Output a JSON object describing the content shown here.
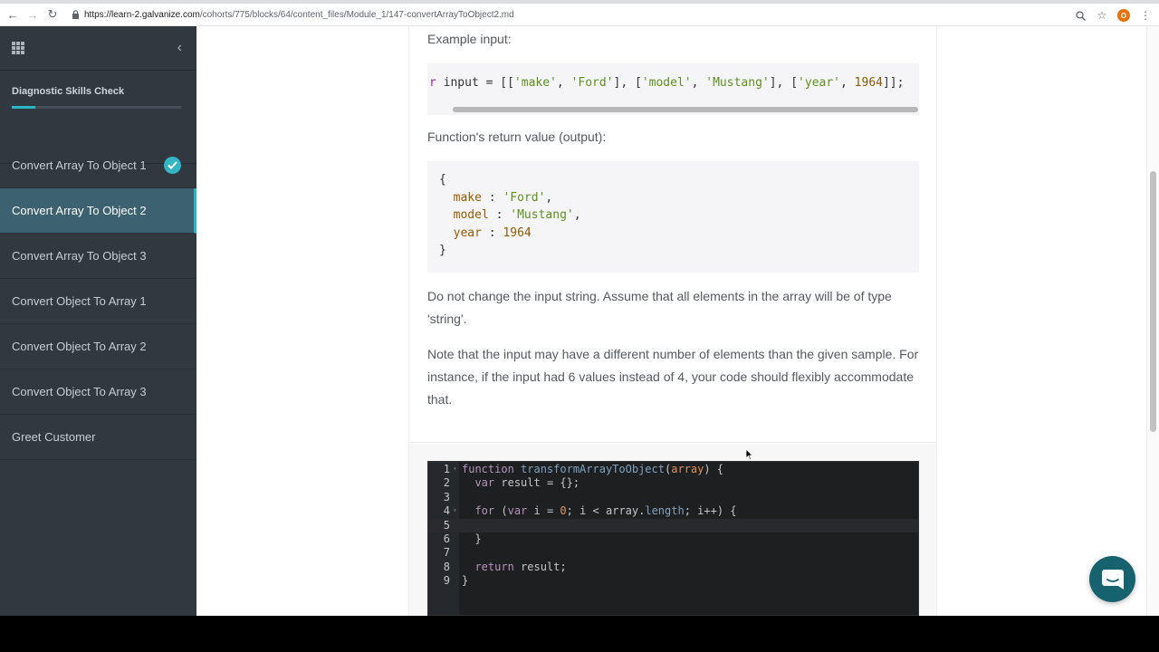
{
  "browser": {
    "url_host": "https://learn-2.galvanize.com",
    "url_path": "/cohorts/775/blocks/64/content_files/Module_1/147-convertArrayToObject2.md",
    "profile_initial": "O"
  },
  "sidebar": {
    "title": "Diagnostic Skills Check",
    "progress": 0.14,
    "items": [
      {
        "label": "Convert Array To Object 1",
        "completed": true
      },
      {
        "label": "Convert Array To Object 2",
        "active": true
      },
      {
        "label": "Convert Array To Object 3"
      },
      {
        "label": "Convert Object To Array 1"
      },
      {
        "label": "Convert Object To Array 2"
      },
      {
        "label": "Convert Object To Array 3"
      },
      {
        "label": "Greet Customer"
      }
    ]
  },
  "content": {
    "example_input_label": "Example input:",
    "input_code": "r input = [['make', 'Ford'], ['model', 'Mustang'], ['year', 1964]];",
    "return_label": "Function's return value (output):",
    "output_code": [
      "{",
      "  make : 'Ford',",
      "  model : 'Mustang',",
      "  year : 1964",
      "}"
    ],
    "para1": "Do not change the input string. Assume that all elements in the array will be of type 'string'.",
    "para2": "Note that the input may have a different number of elements than the given sample. For instance, if the input had 6 values instead of 4, your code should flexibly accommodate that."
  },
  "editor": {
    "lines": [
      "function transformArrayToObject(array) {",
      "  var result = {};",
      "",
      "  for (var i = 0; i < array.length; i++) {",
      "",
      "  }",
      "",
      "  return result;",
      "}"
    ],
    "line_numbers": [
      "1",
      "2",
      "3",
      "4",
      "5",
      "6",
      "7",
      "8",
      "9"
    ],
    "current_line": 5
  },
  "colors": {
    "sidebar_bg": "#313840",
    "sidebar_active": "#3c6272",
    "accent": "#2ab4c4",
    "chat_button": "#17626f"
  }
}
